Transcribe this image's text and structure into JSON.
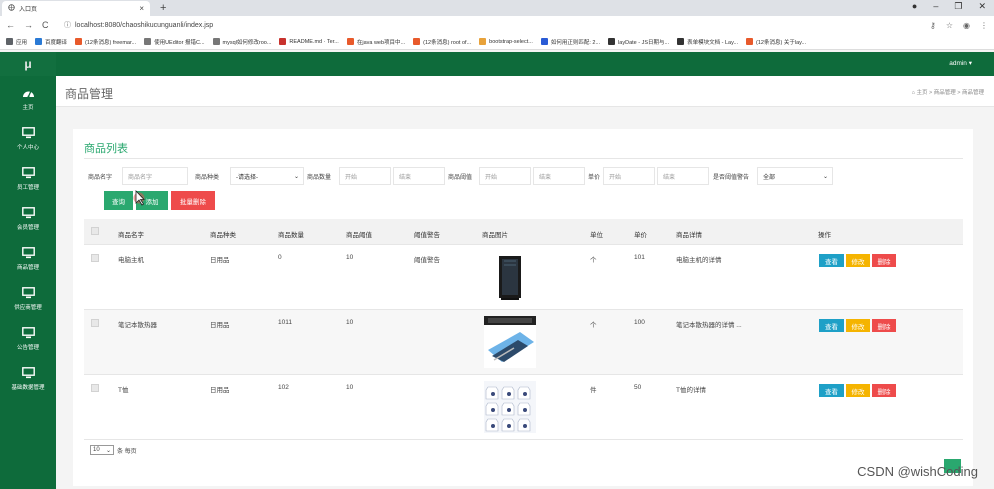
{
  "browser": {
    "tab_title": "入口页",
    "url": "localhost:8080/chaoshikucunguanli/index.jsp",
    "bookmarks": [
      {
        "label": "应用",
        "color": "#5f6368"
      },
      {
        "label": "百度翻译",
        "color": "#2a7ad5"
      },
      {
        "label": "(12条消息) freemar...",
        "color": "#e85a2b"
      },
      {
        "label": "使用UEditor 报错C...",
        "color": "#777777"
      },
      {
        "label": "mysql如何修改roo...",
        "color": "#777777"
      },
      {
        "label": "README.md · Ter...",
        "color": "#c8322d"
      },
      {
        "label": "在java web项目中...",
        "color": "#e85a2b"
      },
      {
        "label": "(12条消息) root of...",
        "color": "#e85a2b"
      },
      {
        "label": "bootstrap-select...",
        "color": "#e8a23a"
      },
      {
        "label": "如何用正则匹配: 2...",
        "color": "#2a5bd5"
      },
      {
        "label": "layDate - JS日期与...",
        "color": "#333333"
      },
      {
        "label": "表单模块文档 - Lay...",
        "color": "#333333"
      },
      {
        "label": "(12条消息) 关于lay...",
        "color": "#e85a2b"
      }
    ]
  },
  "app": {
    "logo": "μ",
    "user": "admin ▾",
    "page_title": "商品管理",
    "breadcrumb": "⌂ 主页 > 商品管理 > 商品管理",
    "colors": {
      "header": "#0e6b3b",
      "accent": "#2aa86f",
      "danger": "#ee4b4b",
      "info": "#1ea0c7",
      "warn": "#f5b400"
    }
  },
  "sidebar": {
    "items": [
      {
        "label": "主页",
        "icon": "dashboard-icon"
      },
      {
        "label": "个人中心",
        "icon": "monitor-icon"
      },
      {
        "label": "员工管理",
        "icon": "monitor-icon"
      },
      {
        "label": "会员管理",
        "icon": "monitor-icon"
      },
      {
        "label": "商品管理",
        "icon": "monitor-icon"
      },
      {
        "label": "供应商管理",
        "icon": "monitor-icon"
      },
      {
        "label": "公告管理",
        "icon": "monitor-icon"
      },
      {
        "label": "基础数据管理",
        "icon": "monitor-icon"
      }
    ]
  },
  "panel": {
    "title": "商品列表",
    "filters": {
      "name_label": "商品名字",
      "name_placeholder": "商品名字",
      "type_label": "商品种类",
      "type_value": "-请选择-",
      "qty_label": "商品数量",
      "qty_start": "开始",
      "qty_end": "结束",
      "threshold_label": "商品阈值",
      "threshold_start": "开始",
      "threshold_end": "结束",
      "price_label": "单价",
      "price_start": "开始",
      "price_end": "结束",
      "warn_label": "是否阈值警告",
      "warn_value": "全部"
    },
    "buttons": {
      "search": "查询",
      "add": "添加",
      "batch_delete": "批量删除"
    },
    "columns": [
      "商品名字",
      "商品种类",
      "商品数量",
      "商品阈值",
      "阈值警告",
      "商品图片",
      "单位",
      "单价",
      "商品详情",
      "操作"
    ],
    "rows": [
      {
        "name": "电脑主机",
        "type": "日用品",
        "qty": "0",
        "threshold": "10",
        "warning": "阈值警告",
        "image": "pc-case-image",
        "unit": "个",
        "price": "101",
        "detail": "电脑主机的详情"
      },
      {
        "name": "笔记本散热器",
        "type": "日用品",
        "qty": "1011",
        "threshold": "10",
        "warning": "",
        "image": "laptop-cooler-image",
        "unit": "个",
        "price": "100",
        "detail": "笔记本散热器的详情 ..."
      },
      {
        "name": "T恤",
        "type": "日用品",
        "qty": "102",
        "threshold": "10",
        "warning": "",
        "image": "tshirt-image",
        "unit": "件",
        "price": "50",
        "detail": "T恤的详情"
      }
    ],
    "row_actions": {
      "view": "查看",
      "edit": "修改",
      "delete": "删除"
    },
    "pager": {
      "page_size": "10",
      "suffix": "条 每页"
    }
  },
  "watermark": "CSDN @wishCoding"
}
